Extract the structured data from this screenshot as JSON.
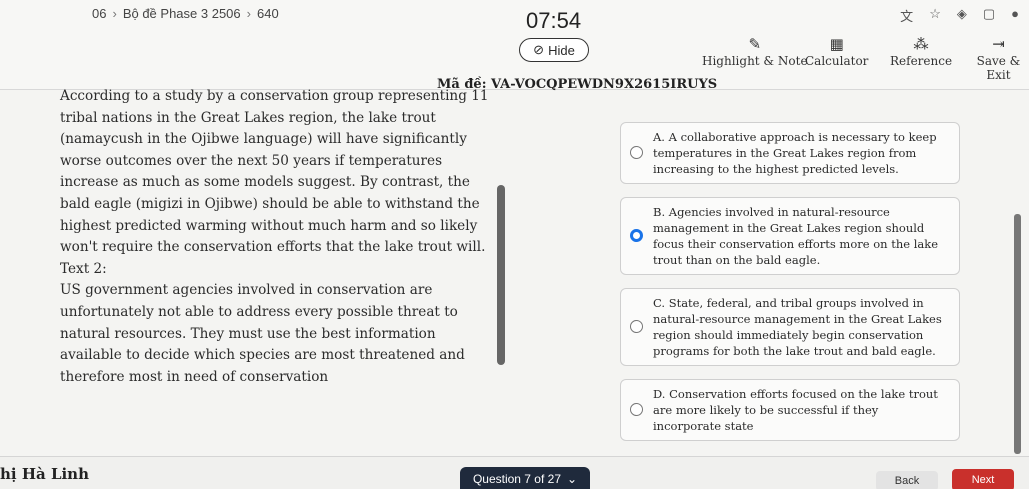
{
  "header": {
    "breadcrumb": [
      "06",
      "Bộ đề Phase 3 2506",
      "640"
    ],
    "timer": "07:54",
    "hide_label": "Hide",
    "tools": [
      {
        "label": "Highlight & Note",
        "icon": "pencil-icon"
      },
      {
        "label": "Calculator",
        "icon": "calculator-icon"
      },
      {
        "label": "Reference",
        "icon": "reference-icon"
      },
      {
        "label": "Save & Exit",
        "icon": "exit-icon"
      }
    ]
  },
  "exam_code": "Mã đề: VA-VOCQPEWDN9X2615IRUYS",
  "passage": {
    "text1": "According to a study by a conservation group representing 11 tribal nations in the Great Lakes region, the lake trout (namaycush in the Ojibwe language) will have significantly worse outcomes over the next 50 years if temperatures increase as much as some models suggest. By contrast, the bald eagle (migizi in Ojibwe) should be able to withstand the highest predicted warming without much harm and so likely won't require the conservation efforts that the lake trout will.",
    "text2_label": "Text 2:",
    "text2": "US government agencies involved in conservation are unfortunately not able to address every possible threat to natural resources. They must use the best information available to decide which species are most threatened and therefore most in need of conservation"
  },
  "choices": [
    {
      "letter": "A.",
      "text": "A collaborative approach is necessary to keep temperatures in the Great Lakes region from increasing to the highest predicted levels.",
      "selected": false
    },
    {
      "letter": "B.",
      "text": "Agencies involved in natural-resource management in the Great Lakes region should focus their conservation efforts more on the lake trout than on the bald eagle.",
      "selected": true
    },
    {
      "letter": "C.",
      "text": "State, federal, and tribal groups involved in natural-resource management in the Great Lakes region should immediately begin conservation programs for both the lake trout and bald eagle.",
      "selected": false
    },
    {
      "letter": "D.",
      "text": "Conservation efforts focused on the lake trout are more likely to be successful if they incorporate state",
      "selected": false
    }
  ],
  "footer": {
    "student": "hị Hà Linh",
    "question_label": "Question 7 of 27",
    "back_label": "Back",
    "next_label": "Next"
  },
  "colors": {
    "accent": "#1a73e8",
    "next": "#c9302c",
    "question_bar": "#1f2a3c"
  }
}
